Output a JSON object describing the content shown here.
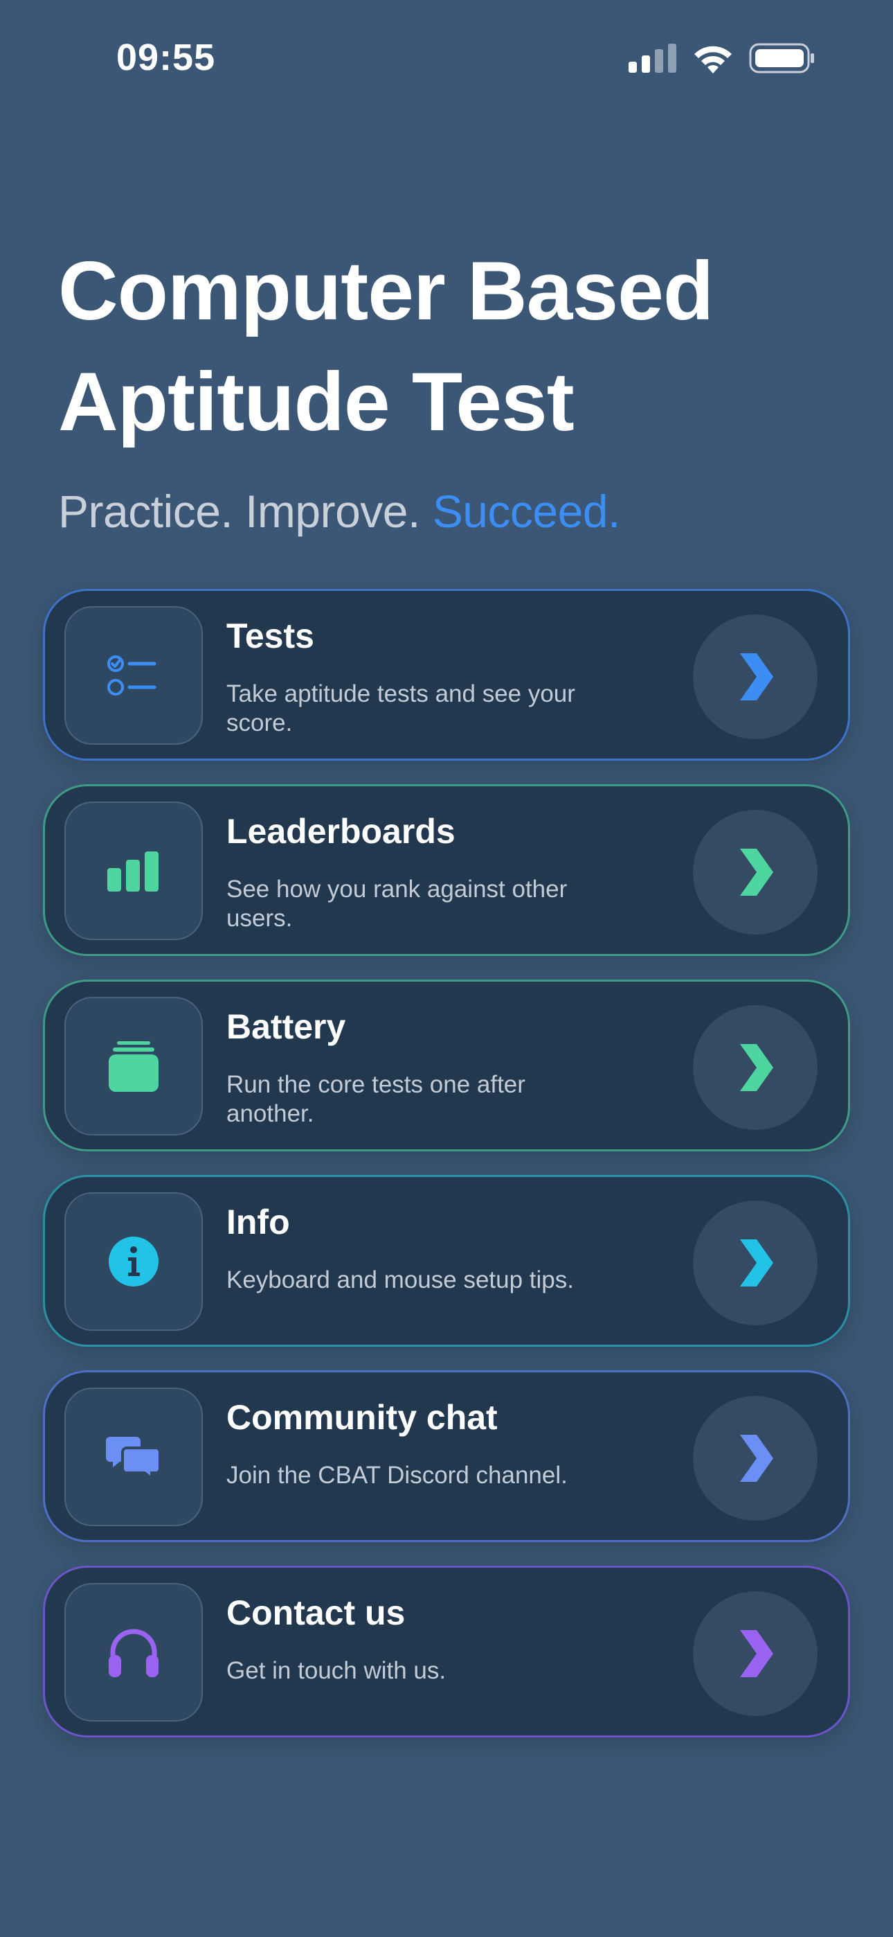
{
  "status_bar": {
    "time": "09:55",
    "icons": [
      "signal-icon",
      "wifi-icon",
      "battery-icon"
    ]
  },
  "header": {
    "title_line1": "Computer Based",
    "title_line2": "Aptitude Test",
    "tagline_prefix": "Practice. Improve.",
    "tagline_accent": "Succeed."
  },
  "menu": [
    {
      "id": "tests",
      "title": "Tests",
      "description": "Take aptitude tests and see your score.",
      "icon": "checklist-icon",
      "accent": "#3d8ef4"
    },
    {
      "id": "leaderboards",
      "title": "Leaderboards",
      "description": "See how you rank against other users.",
      "icon": "bar-chart-icon",
      "accent": "#4fd59f"
    },
    {
      "id": "battery",
      "title": "Battery",
      "description": "Run the core tests one after another.",
      "icon": "stack-icon",
      "accent": "#4fd59f"
    },
    {
      "id": "info",
      "title": "Info",
      "description": "Keyboard and mouse setup tips.",
      "icon": "info-icon",
      "accent": "#22c3e6"
    },
    {
      "id": "community",
      "title": "Community chat",
      "description": "Join the CBAT Discord channel.",
      "icon": "chat-bubbles-icon",
      "accent": "#6b8ff5"
    },
    {
      "id": "contact",
      "title": "Contact us",
      "description": "Get in touch with us.",
      "icon": "headphones-icon",
      "accent": "#9b63f2"
    }
  ]
}
